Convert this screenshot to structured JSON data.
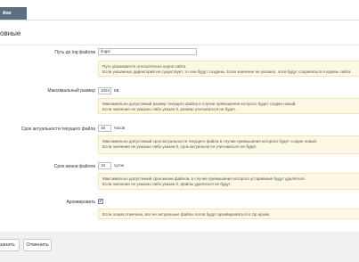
{
  "tabs": {
    "active": "йки"
  },
  "section": {
    "title": "овные"
  },
  "fields": {
    "log_path": {
      "label": "Путь до log файлов",
      "value": "/logs/",
      "hint": [
        "Путь указывается относительно корня сайта.",
        "Если указанных директорий не существует, то они будут созданы. Если значение не указано, логи будут сохраняться в корень сайта."
      ]
    },
    "max_size": {
      "label": "Максимальный размер",
      "value": "1024",
      "unit": "КБ",
      "hint": [
        "Максимально допустимый размер текущего файла в случае превышения которого будет создан новый.",
        "Если значение не указано либо указан 0, размер учитываться не будет."
      ]
    },
    "current_lifetime": {
      "label": "Срок актуальности текущего файла",
      "value": "48",
      "unit": "часов",
      "hint": [
        "Максимально допустимый срок актуальности текущего файла в случае превышения которого будет создан новый.",
        "Если значение не указано либо указан 0, срок актуальности учитываться не будет."
      ]
    },
    "file_lifetime": {
      "label": "Срок жизни файлов",
      "value": "10",
      "unit": "суток",
      "hint": [
        "Максимально допустимый срок жизни файлов, в случае превышения которого устаревшие будут удаляться.",
        "Если значение не указано либо указан 0, файлы удаляться не будут."
      ]
    },
    "archive": {
      "label": "Архивировать",
      "checked": "✔",
      "hint": [
        "Если опция отмечена, все не актуальные файлы логов будут архивироваться в zip архив."
      ]
    }
  },
  "footer": {
    "save_label": "ранить",
    "cancel_label": "Отменить"
  }
}
